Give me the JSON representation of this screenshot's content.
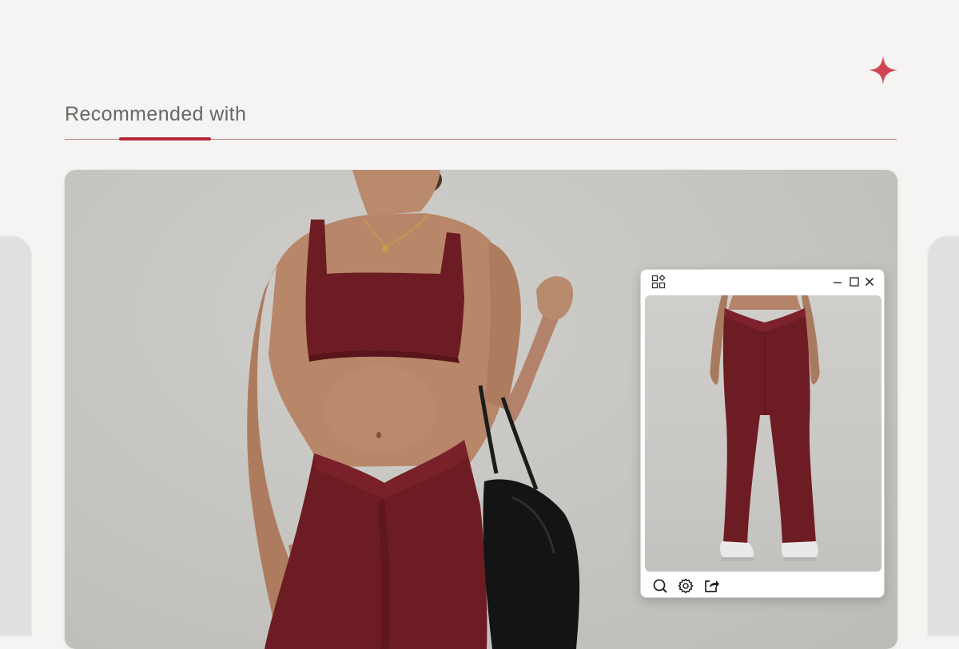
{
  "section": {
    "title": "Recommended with"
  },
  "icons": {
    "sparkle": "sparkle-icon",
    "apps": "apps-grid-icon",
    "minimize": "minimize-icon",
    "maximize": "maximize-icon",
    "close": "close-icon",
    "search": "search-icon",
    "settings": "gear-icon",
    "share": "share-icon"
  },
  "colors": {
    "background": "#f6f4f2",
    "accent": "#b32636",
    "title_text": "#6a6866",
    "garment": "#6e1c24"
  }
}
